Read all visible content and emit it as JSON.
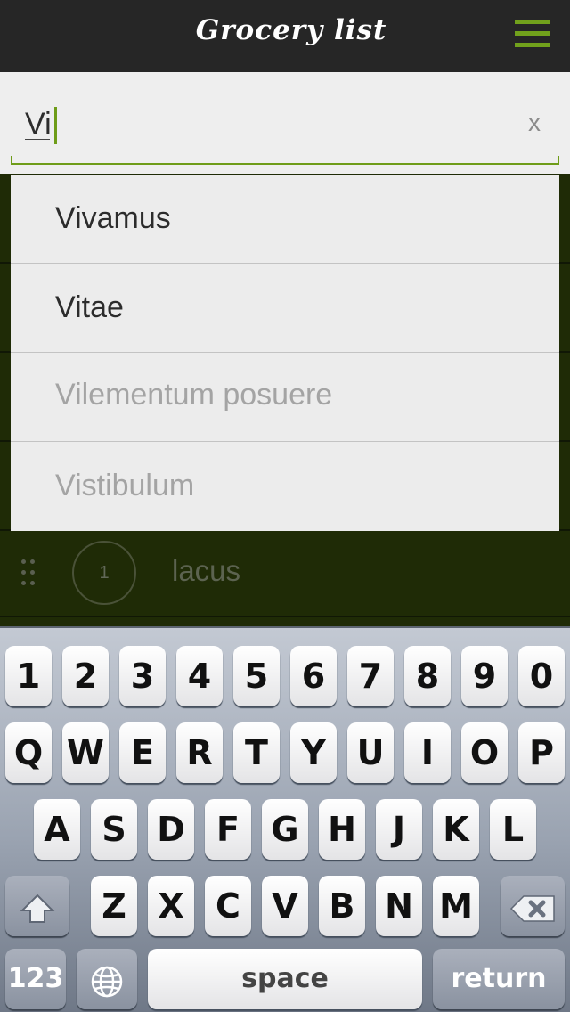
{
  "header": {
    "title": "Grocery list",
    "menu_icon": "hamburger-menu-icon",
    "accent": "#71a11c"
  },
  "search": {
    "value": "Vi",
    "clear_label": "x",
    "clear_icon": "close-icon"
  },
  "suggestions": [
    {
      "label": "Vivamus",
      "active": true
    },
    {
      "label": "Vitae",
      "active": true
    },
    {
      "label": "Vilementum posuere",
      "active": false
    },
    {
      "label": "Vistibulum",
      "active": false
    }
  ],
  "list": {
    "items": [
      {
        "quantity": "1",
        "label": "lacus"
      }
    ]
  },
  "keyboard": {
    "row1": [
      "1",
      "2",
      "3",
      "4",
      "5",
      "6",
      "7",
      "8",
      "9",
      "0"
    ],
    "row2": [
      "Q",
      "W",
      "E",
      "R",
      "T",
      "Y",
      "U",
      "I",
      "O",
      "P"
    ],
    "row3": [
      "A",
      "S",
      "D",
      "F",
      "G",
      "H",
      "J",
      "K",
      "L"
    ],
    "row4": [
      "Z",
      "X",
      "C",
      "V",
      "B",
      "N",
      "M"
    ],
    "numbers_label": "123",
    "space_label": "space",
    "return_label": "return",
    "shift_icon": "shift-icon",
    "delete_icon": "backspace-icon",
    "globe_icon": "globe-icon"
  },
  "colors": {
    "header_bg": "#262626",
    "list_bg": "#1f2b06",
    "search_bg": "#eeeeee"
  }
}
